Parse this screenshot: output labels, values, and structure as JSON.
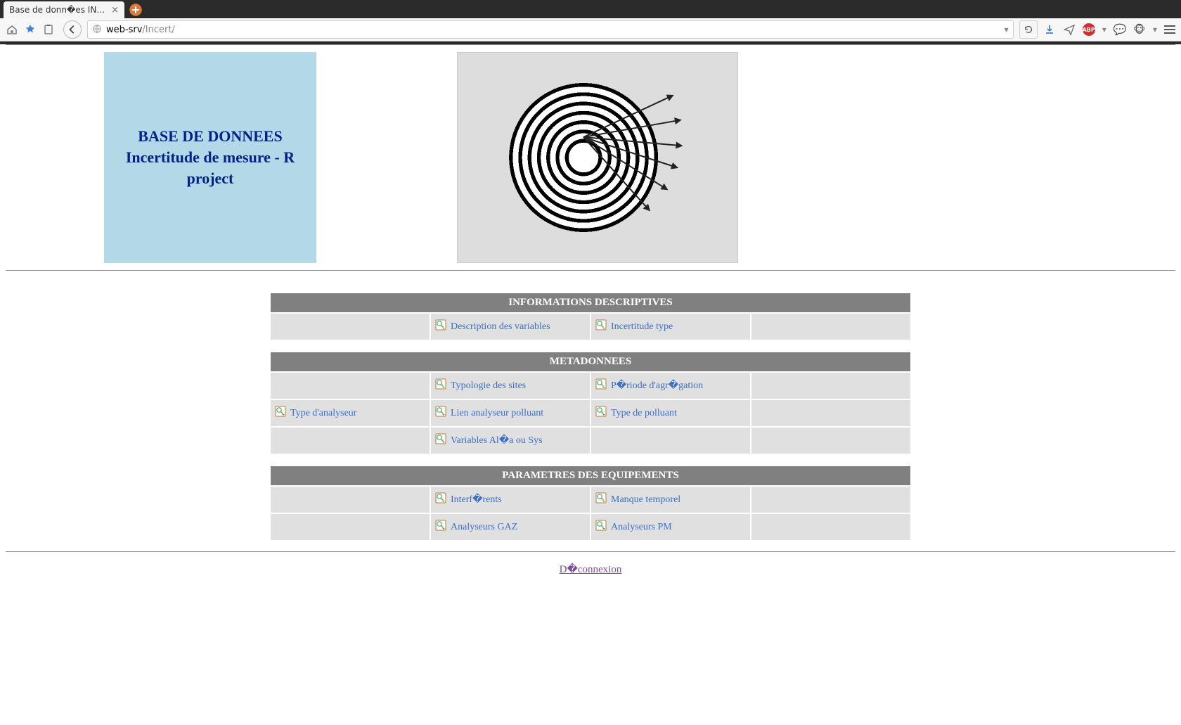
{
  "browser": {
    "tab_title": "Base de donn�es INCE...",
    "url_host": "web-srv",
    "url_path": "/Incert/"
  },
  "header": {
    "title_line1": "BASE DE DONNEES",
    "title_line2": "Incertitude de mesure - R project"
  },
  "sections": [
    {
      "title": "INFORMATIONS DESCRIPTIVES",
      "rows": [
        [
          "",
          "Description des variables",
          "Incertitude type",
          ""
        ]
      ]
    },
    {
      "title": "METADONNEES",
      "rows": [
        [
          "",
          "Typologie des sites",
          "P�riode d'agr�gation",
          ""
        ],
        [
          "Type d'analyseur",
          "Lien analyseur polluant",
          "Type de polluant",
          ""
        ],
        [
          "",
          "Variables Al�a ou Sys",
          "",
          ""
        ]
      ]
    },
    {
      "title": "PARAMETRES DES EQUIPEMENTS",
      "rows": [
        [
          "",
          "Interf�rents",
          "Manque temporel",
          ""
        ],
        [
          "",
          "Analyseurs GAZ",
          "Analyseurs PM",
          ""
        ]
      ]
    }
  ],
  "logout_label": "D�connexion"
}
